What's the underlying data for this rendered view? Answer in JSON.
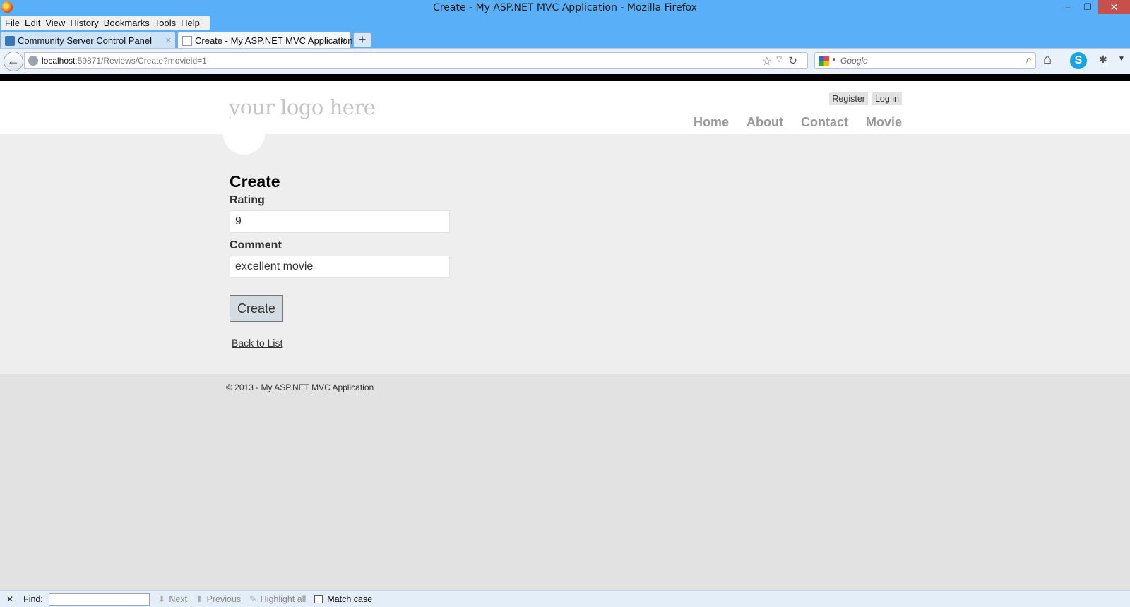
{
  "window": {
    "title": "Create - My ASP.NET MVC Application - Mozilla Firefox",
    "minimize": "–",
    "maximize": "❐",
    "close": "✕"
  },
  "menu": [
    "File",
    "Edit",
    "View",
    "History",
    "Bookmarks",
    "Tools",
    "Help"
  ],
  "tabs": [
    {
      "label": "Community Server Control Panel",
      "close": "×"
    },
    {
      "label": "Create - My ASP.NET MVC Application",
      "close": "×"
    }
  ],
  "new_tab": "+",
  "urlbar": {
    "host": "localhost",
    "path": ":59871/Reviews/Create?movieid=1"
  },
  "search": {
    "placeholder": "Google"
  },
  "site": {
    "logo": "your logo here",
    "login_links": {
      "register": "Register",
      "login": "Log in"
    },
    "nav": {
      "home": "Home",
      "about": "About",
      "contact": "Contact",
      "movie": "Movie"
    }
  },
  "form": {
    "title": "Create",
    "rating_label": "Rating",
    "rating_value": "9",
    "comment_label": "Comment",
    "comment_value": "excellent movie",
    "submit": "Create",
    "back_link": "Back to List"
  },
  "footer": {
    "text": "© 2013 - My ASP.NET MVC Application"
  },
  "findbar": {
    "close": "✕",
    "label": "Find:",
    "value": "",
    "next": "Next",
    "previous": "Previous",
    "highlight": "Highlight all",
    "match_case": "Match case"
  },
  "icons": {
    "back": "back-arrow-icon",
    "star": "bookmark-star-icon",
    "reload": "reload-icon",
    "home": "home-icon",
    "skype": "skype-icon",
    "search": "magnifier-icon"
  },
  "colors": {
    "titlebar": "#5ab0f8",
    "close_button": "#c7504a",
    "content_bg": "#efeeef",
    "footer_bg": "#e2e2e2",
    "button_bg": "#d3dce0",
    "nav_link": "#999999",
    "logo": "#c4c4c4"
  }
}
